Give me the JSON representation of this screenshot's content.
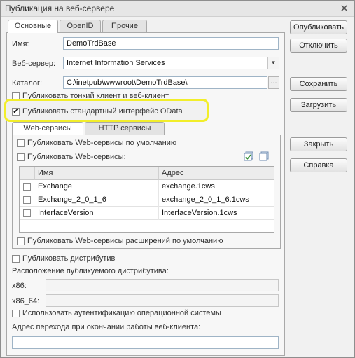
{
  "window": {
    "title": "Публикация на веб-сервере",
    "close_icon": "close-icon"
  },
  "tabs": [
    {
      "label": "Основные"
    },
    {
      "label": "OpenID"
    },
    {
      "label": "Прочие"
    }
  ],
  "form": {
    "name_label": "Имя:",
    "name_value": "DemoTrdBase",
    "webserver_label": "Веб-сервер:",
    "webserver_value": "Internet Information Services",
    "catalog_label": "Каталог:",
    "catalog_value": "C:\\inetpub\\wwwroot\\DemoTrdBase\\",
    "browse_label": "...",
    "thin_client_label": "Публиковать тонкий клиент и веб-клиент",
    "odata_label": "Публиковать стандартный интерфейс OData",
    "odata_checked": true
  },
  "subtabs": [
    {
      "label": "Web-сервисы"
    },
    {
      "label": "HTTP сервисы"
    }
  ],
  "webservices": {
    "default_label": "Публиковать Web-сервисы по умолчанию",
    "publish_label": "Публиковать Web-сервисы:",
    "col_name": "Имя",
    "col_address": "Адрес",
    "rows": [
      {
        "name": "Exchange",
        "address": "exchange.1cws"
      },
      {
        "name": "Exchange_2_0_1_6",
        "address": "exchange_2_0_1_6.1cws"
      },
      {
        "name": "InterfaceVersion",
        "address": "InterfaceVersion.1cws"
      }
    ],
    "extensions_label": "Публиковать Web-сервисы расширений по умолчанию"
  },
  "distrib": {
    "publish_label": "Публиковать дистрибутив",
    "location_label": "Расположение публикуемого дистрибутива:",
    "x86_label": "x86:",
    "x86_64_label": "x86_64:",
    "os_auth_label": "Использовать аутентификацию операционной системы",
    "exit_url_label": "Адрес перехода при окончании работы веб-клиента:"
  },
  "buttons": {
    "publish": "Опубликовать",
    "disable": "Отключить",
    "save": "Сохранить",
    "load": "Загрузить",
    "close": "Закрыть",
    "help": "Справка"
  },
  "colors": {
    "highlight": "#f2ee2a",
    "field_border": "#9fb4c6"
  }
}
